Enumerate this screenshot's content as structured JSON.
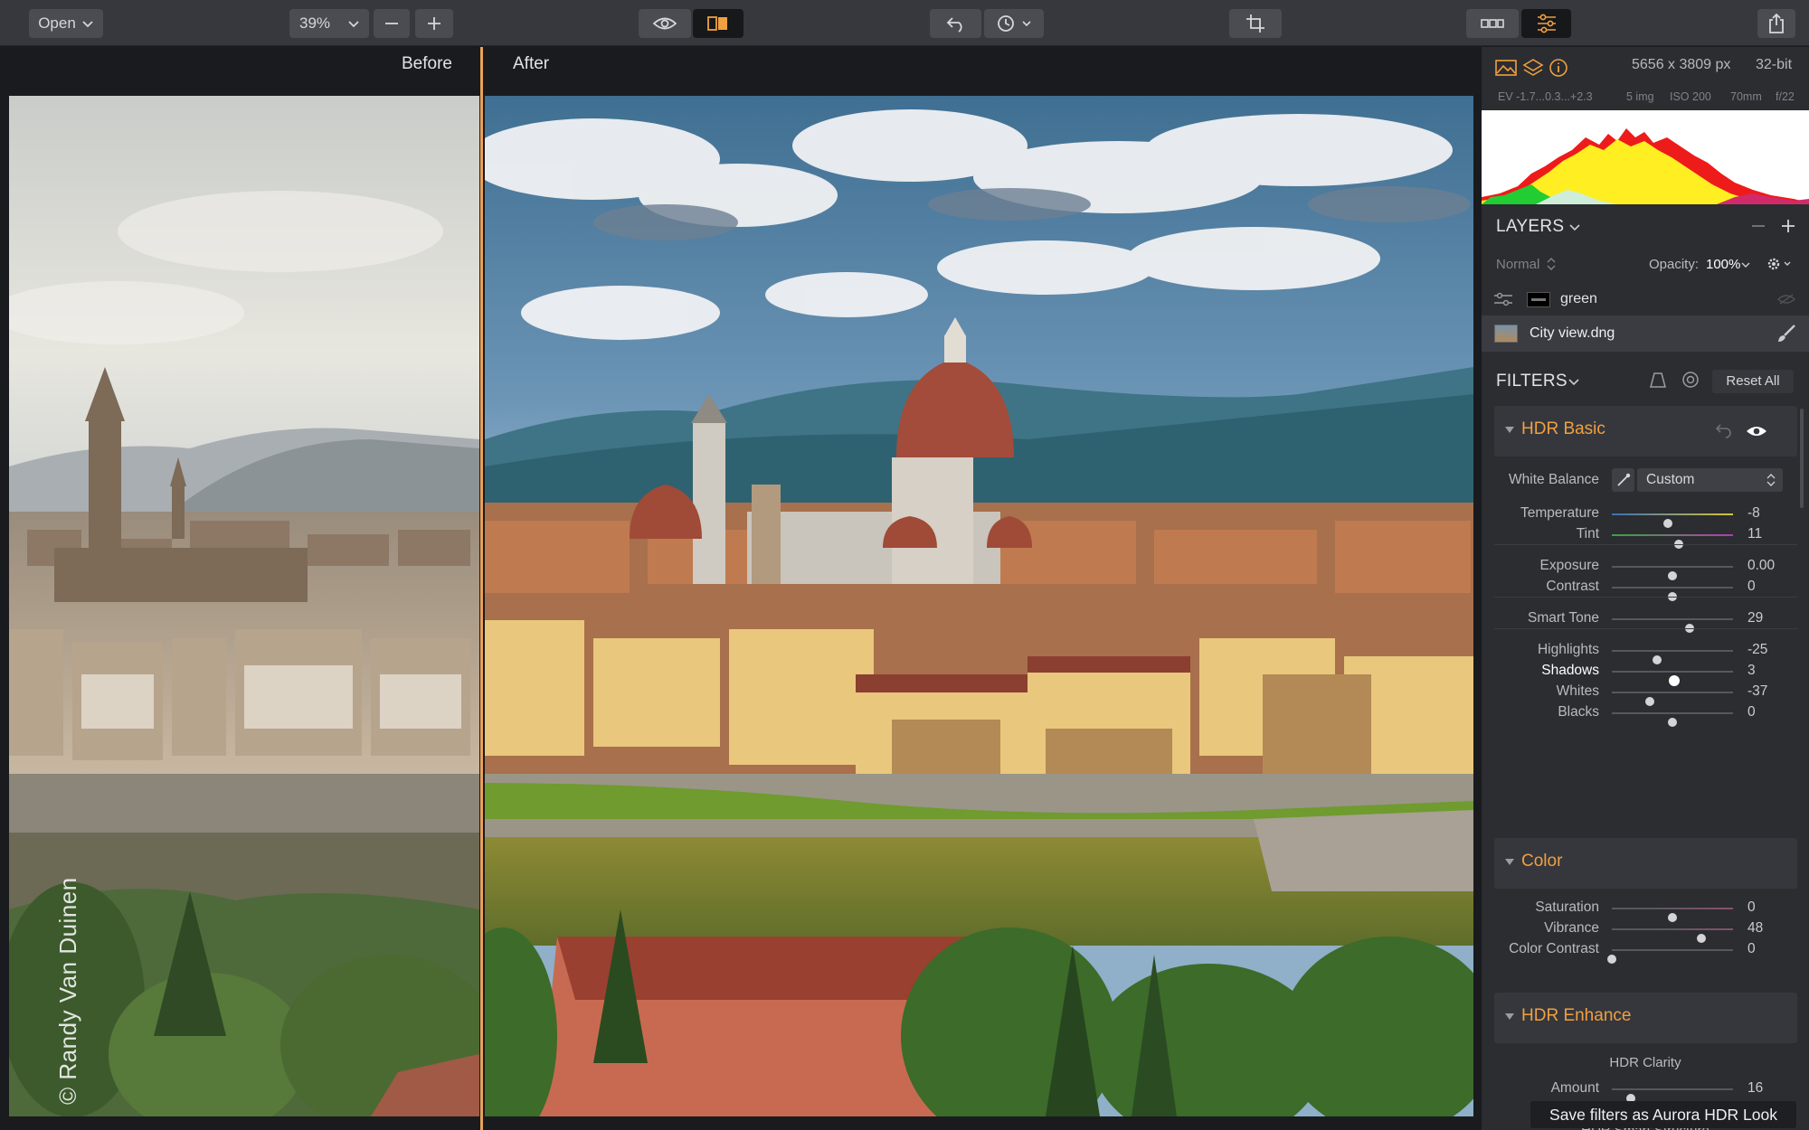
{
  "toolbar": {
    "open_label": "Open",
    "zoom_value": "39%",
    "icons": [
      "chevron-down-icon",
      "minus-icon",
      "plus-icon",
      "eye-icon",
      "compare-icon",
      "undo-icon",
      "history-icon",
      "crop-icon",
      "filmstrip-icon",
      "adjustments-icon",
      "share-icon"
    ]
  },
  "canvas": {
    "before_label": "Before",
    "after_label": "After",
    "watermark": "© Randy Van Duinen",
    "split_color": "#e9a15a"
  },
  "info": {
    "dimensions": "5656 x 3809 px",
    "bit_depth": "32-bit",
    "ev": "EV  -1.7...0.3...+2.3",
    "images": "5 img",
    "iso": "ISO 200",
    "focal": "70mm",
    "aperture": "f/22"
  },
  "layers": {
    "title": "LAYERS",
    "blend_mode": "Normal",
    "opacity_label": "Opacity:",
    "opacity_value": "100%",
    "items": [
      {
        "name": "green",
        "selected": false
      },
      {
        "name": "City view.dng",
        "selected": true
      }
    ]
  },
  "filters": {
    "title": "FILTERS",
    "reset_label": "Reset All",
    "accent": "#f0a040",
    "hdr_basic": {
      "title": "HDR Basic",
      "white_balance_label": "White Balance",
      "white_balance_value": "Custom",
      "sliders": [
        {
          "label": "Temperature",
          "value": "-8",
          "pos": 0.46
        },
        {
          "label": "Tint",
          "value": "11",
          "pos": 0.555
        },
        {
          "label": "Exposure",
          "value": "0.00",
          "pos": 0.5
        },
        {
          "label": "Contrast",
          "value": "0",
          "pos": 0.5
        },
        {
          "label": "Smart Tone",
          "value": "29",
          "pos": 0.645
        },
        {
          "label": "Highlights",
          "value": "-25",
          "pos": 0.375
        },
        {
          "label": "Shadows",
          "value": "3",
          "pos": 0.515
        },
        {
          "label": "Whites",
          "value": "-37",
          "pos": 0.315
        },
        {
          "label": "Blacks",
          "value": "0",
          "pos": 0.5
        }
      ]
    },
    "color": {
      "title": "Color",
      "sliders": [
        {
          "label": "Saturation",
          "value": "0",
          "pos": 0.5
        },
        {
          "label": "Vibrance",
          "value": "48",
          "pos": 0.74
        },
        {
          "label": "Color Contrast",
          "value": "0",
          "pos": 0.0
        }
      ]
    },
    "hdr_enhance": {
      "title": "HDR Enhance",
      "clarity_heading": "HDR Clarity",
      "amount_label": "Amount",
      "amount_value": "16",
      "amount_pos": 0.16,
      "structure_heading": "HDR Smart Structure"
    }
  },
  "save_label": "Save filters as Aurora HDR Look"
}
